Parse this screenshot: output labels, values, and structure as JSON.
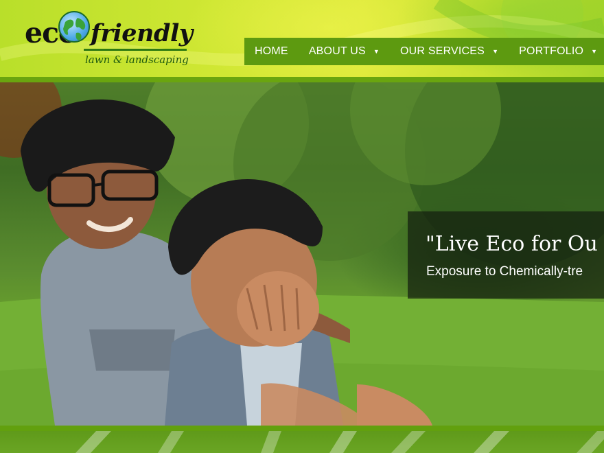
{
  "brand": {
    "logo_eco": "eco",
    "logo_friendly": "friendly",
    "tagline": "lawn & landscaping"
  },
  "nav": {
    "items": [
      {
        "label": "HOME",
        "has_dropdown": false
      },
      {
        "label": "ABOUT US",
        "has_dropdown": true
      },
      {
        "label": "OUR SERVICES",
        "has_dropdown": true
      },
      {
        "label": "PORTFOLIO",
        "has_dropdown": true
      }
    ],
    "caret": "▼"
  },
  "hero": {
    "quote": "\"Live Eco for Ou",
    "subtext": "Exposure to Chemically-tre"
  },
  "colors": {
    "header_gradient": "#cfe733",
    "nav_bg": "#5d9a10",
    "accent_green": "#6aa50f",
    "caption_bg": "#141e0f"
  },
  "icons": {
    "logo_globe": "globe-icon",
    "dropdown": "chevron-down-icon"
  }
}
